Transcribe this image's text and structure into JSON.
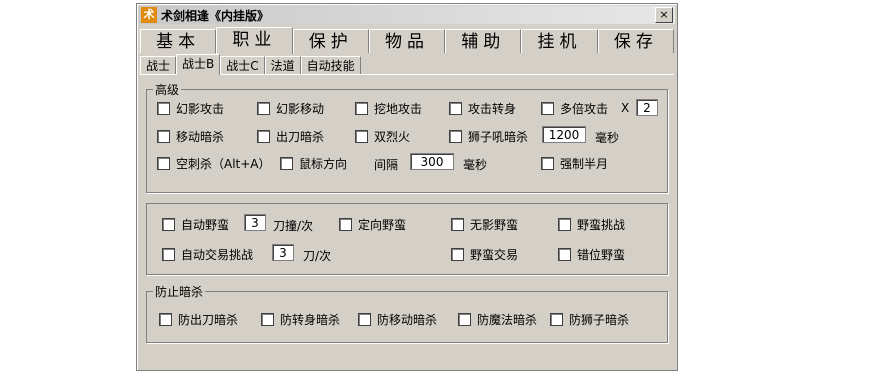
{
  "window": {
    "title": "术剑相逢《内挂版》",
    "icon_glyph": "术",
    "close_glyph": "×"
  },
  "main_tabs": [
    "基本",
    "职业",
    "保护",
    "物品",
    "辅助",
    "挂机",
    "保存"
  ],
  "sub_tabs": [
    "战士",
    "战士B",
    "战士C",
    "法道",
    "自动技能"
  ],
  "advanced": {
    "legend": "高级",
    "magic_attack": "幻影攻击",
    "magic_move": "幻影移动",
    "dig_attack": "挖地攻击",
    "attack_turn": "攻击转身",
    "multi_attack": "多倍攻击",
    "multi_x": "X",
    "multi_value": "2",
    "move_assassin": "移动暗杀",
    "blade_assassin": "出刀暗杀",
    "double_fire": "双烈火",
    "lion_roar": "狮子吼暗杀",
    "lion_value": "1200",
    "lion_unit": "毫秒",
    "air_stab": "空刺杀（Alt+A）",
    "mouse_dir": "鼠标方向",
    "interval_label": "间隔",
    "interval_value": "300",
    "interval_unit": "毫秒",
    "force_half_moon": "强制半月"
  },
  "savage": {
    "auto_savage": "自动野蛮",
    "auto_savage_value": "3",
    "auto_savage_unit": "刀撞/次",
    "directed_savage": "定向野蛮",
    "shadowless_savage": "无影野蛮",
    "savage_challenge": "野蛮挑战",
    "auto_trade_challenge": "自动交易挑战",
    "trade_value": "3",
    "trade_unit": "刀/次",
    "savage_trade": "野蛮交易",
    "offset_savage": "错位野蛮"
  },
  "anti_assassin": {
    "legend": "防止暗杀",
    "anti_blade": "防出刀暗杀",
    "anti_turn": "防转身暗杀",
    "anti_move": "防移动暗杀",
    "anti_magic": "防魔法暗杀",
    "anti_lion": "防狮子暗杀"
  }
}
